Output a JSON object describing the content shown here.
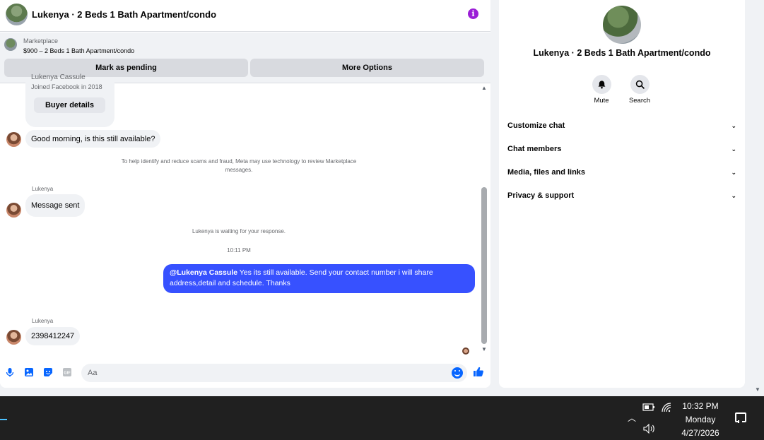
{
  "header": {
    "title": "Lukenya · 2 Beds 1 Bath Apartment/condo",
    "info_icon": "info-icon"
  },
  "marketplace": {
    "label": "Marketplace",
    "listing": "$900 – 2 Beds 1 Bath Apartment/condo",
    "btn_pending": "Mark as pending",
    "btn_more": "More Options"
  },
  "profile_card": {
    "name": "Lukenya Cassule",
    "joined": "Joined Facebook in 2018",
    "button": "Buyer details"
  },
  "messages": {
    "msg1": "Good morning, is this still available?",
    "notice": "To help identify and reduce scams and fraud, Meta may use technology to review Marketplace messages.",
    "sender1": "Lukenya",
    "msg2": "Message sent",
    "waiting": "Lukenya is waiting for your response.",
    "time": "10:11 PM",
    "out_mention": "@Lukenya Cassule",
    "out_text": " Yes its still available. Send your contact number i will share address,detail and schedule. Thanks",
    "sender2": "Lukenya",
    "msg3": "2398412247"
  },
  "composer": {
    "placeholder": "Aa",
    "icons": [
      "microphone-icon",
      "image-icon",
      "sticker-icon",
      "gif-icon",
      "emoji-icon",
      "thumbs-up-icon"
    ]
  },
  "info_panel": {
    "title": "Lukenya · 2 Beds 1 Bath Apartment/condo",
    "mute": "Mute",
    "search": "Search",
    "rows": [
      "Customize chat",
      "Chat members",
      "Media, files and links",
      "Privacy & support"
    ]
  },
  "taskbar": {
    "time": "10:32 PM",
    "day": "Monday",
    "date": "4/27/2026"
  },
  "colors": {
    "accent": "#0866ff",
    "outgoing_bubble": "#3751ff",
    "info_purple": "#9b1ed6",
    "taskbar": "#202020"
  }
}
